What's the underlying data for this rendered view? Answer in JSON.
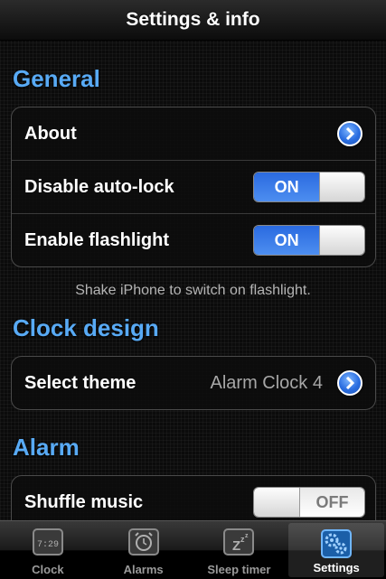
{
  "nav": {
    "title": "Settings & info"
  },
  "sections": {
    "general": {
      "header": "General",
      "rows": {
        "about": {
          "label": "About"
        },
        "auto_lock": {
          "label": "Disable auto-lock",
          "state": "ON"
        },
        "flashlight": {
          "label": "Enable flashlight",
          "state": "ON"
        }
      },
      "note": "Shake iPhone to switch on flashlight."
    },
    "clock_design": {
      "header": "Clock design",
      "rows": {
        "theme": {
          "label": "Select theme",
          "value": "Alarm Clock 4"
        }
      }
    },
    "alarm": {
      "header": "Alarm",
      "rows": {
        "shuffle": {
          "label": "Shuffle music",
          "state": "OFF"
        }
      }
    }
  },
  "tabbar": {
    "clock_icon_text": "7:29",
    "tabs": [
      {
        "label": "Clock",
        "icon": "clock-icon"
      },
      {
        "label": "Alarms",
        "icon": "alarm-icon"
      },
      {
        "label": "Sleep timer",
        "icon": "sleep-zzz-icon"
      },
      {
        "label": "Settings",
        "icon": "settings-gears-icon",
        "selected": true
      }
    ]
  },
  "colors": {
    "accent": "#58aaf5",
    "switch_on": "#3a7ee8"
  }
}
